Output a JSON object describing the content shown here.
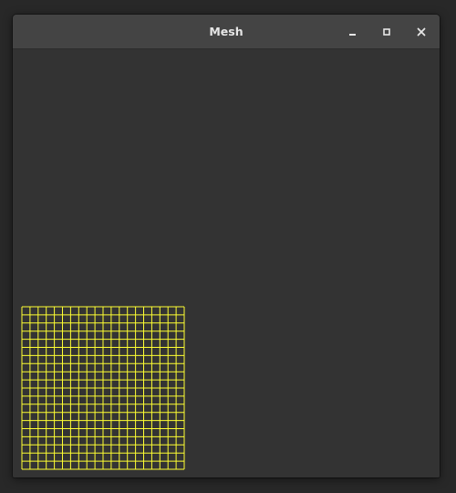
{
  "window": {
    "title": "Mesh",
    "controls": {
      "minimize_icon": "minimize-icon",
      "maximize_icon": "maximize-icon",
      "close_icon": "close-icon"
    }
  },
  "canvas": {
    "background": "#333333",
    "mesh": {
      "color": "#ffff33",
      "columns": 20,
      "rows": 20
    }
  }
}
